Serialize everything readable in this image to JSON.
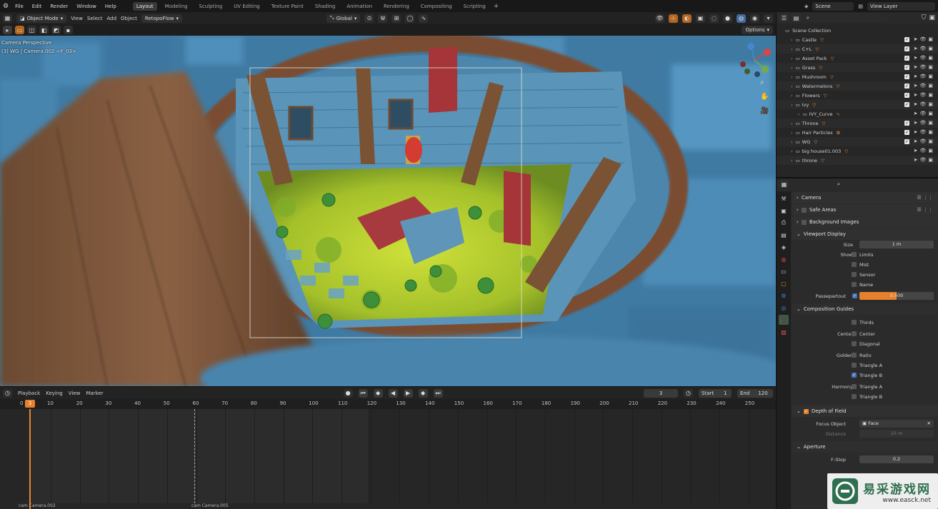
{
  "topbar": {
    "menus": [
      "File",
      "Edit",
      "Render",
      "Window",
      "Help"
    ],
    "workspaces": [
      "Layout",
      "Modeling",
      "Sculpting",
      "UV Editing",
      "Texture Paint",
      "Shading",
      "Animation",
      "Rendering",
      "Compositing",
      "Scripting"
    ],
    "active_workspace": "Layout",
    "scene": "Scene",
    "view_layer": "View Layer"
  },
  "viewport": {
    "mode": "Object Mode",
    "menus": [
      "View",
      "Select",
      "Add",
      "Object"
    ],
    "addon_menu": "RetopoFlow",
    "transform_orientation": "Global",
    "options": "Options",
    "overlay_line1": "Camera Perspective",
    "overlay_line2": "(3) WG | Camera.002 <F_03>",
    "accent": "#4772b3"
  },
  "timeline": {
    "menus": [
      "Playback",
      "Keying",
      "View",
      "Marker"
    ],
    "current_frame": "3",
    "start_label": "Start",
    "start": "1",
    "end_label": "End",
    "end": "120",
    "ruler_start": "0",
    "ruler_marker": "3",
    "ticks": [
      "10",
      "20",
      "30",
      "40",
      "50",
      "60",
      "70",
      "80",
      "90",
      "100",
      "110",
      "120",
      "130",
      "140",
      "150",
      "160",
      "170",
      "180",
      "190",
      "200",
      "210",
      "220",
      "230",
      "240",
      "250"
    ],
    "marker_left": "cam Camera.002",
    "marker_right": "cam Camera.005",
    "playhead_color": "#e5802c"
  },
  "outliner": {
    "root": "Scene Collection",
    "items": [
      {
        "name": "Castle",
        "icon": "cone-icon",
        "checked": true
      },
      {
        "name": "C+L",
        "icon": "cone-icon",
        "checked": true
      },
      {
        "name": "Asset Pack",
        "icon": "cone-icon",
        "checked": true
      },
      {
        "name": "Grass",
        "icon": "cone-icon",
        "checked": true
      },
      {
        "name": "Mushroom",
        "icon": "cone-icon",
        "checked": true
      },
      {
        "name": "Watermelons",
        "icon": "cone-icon",
        "checked": true
      },
      {
        "name": "Flowers",
        "icon": "cone-icon",
        "checked": true
      },
      {
        "name": "Ivy",
        "icon": "cone-icon",
        "checked": true
      },
      {
        "name": "IVY_Curve",
        "icon": "curve-icon",
        "checked": false
      },
      {
        "name": "Throne",
        "icon": "cone-icon",
        "checked": true
      },
      {
        "name": "Hair Particles",
        "icon": "particles-icon",
        "checked": true
      },
      {
        "name": "WG",
        "icon": "cone-icon",
        "checked": true
      },
      {
        "name": "big house01.003",
        "icon": "mesh-icon",
        "checked": false
      },
      {
        "name": "throne",
        "icon": "mesh-icon",
        "checked": false
      }
    ]
  },
  "properties": {
    "camera": "Camera",
    "safe_areas": "Safe Areas",
    "background_images": "Background Images",
    "viewport_display": "Viewport Display",
    "size_label": "Size",
    "size": "1 m",
    "show_label": "Show",
    "limits": "Limits",
    "mist": "Mist",
    "sensor": "Sensor",
    "name": "Name",
    "passepartout_label": "Passepartout",
    "passepartout_value": "0.500",
    "passepartout_fraction": 0.5,
    "composition_guides": "Composition Guides",
    "thirds": "Thirds",
    "center_label": "Center",
    "center": "Center",
    "diagonal": "Diagonal",
    "golden_label": "Golden",
    "ratio": "Ratio",
    "triangle_a": "Triangle A",
    "triangle_b": "Triangle B",
    "harmony_label": "Harmony",
    "h_triangle_a": "Triangle A",
    "h_triangle_b": "Triangle B",
    "depth_of_field": "Depth of Field",
    "focus_object_label": "Focus Object",
    "focus_object": "Face",
    "distance_label": "Distance",
    "distance": "10 m",
    "aperture": "Aperture",
    "fstop_label": "F-Stop",
    "fstop": "0.2"
  },
  "watermark": {
    "title": "易采游戏网",
    "url": "www.easck.net"
  }
}
